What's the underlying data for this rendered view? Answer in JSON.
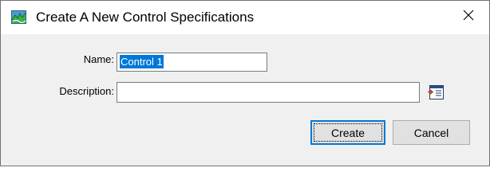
{
  "window": {
    "title": "Create A New Control Specifications",
    "app_icon": "hec-hms-icon",
    "close_icon": "close-icon"
  },
  "form": {
    "name_label": "Name:",
    "name_value": "Control 1",
    "description_label": "Description:",
    "description_value": "",
    "description_editor_icon": "text-editor-icon"
  },
  "buttons": {
    "create_label": "Create",
    "cancel_label": "Cancel"
  },
  "colors": {
    "selection": "#0078d7",
    "dialog_background": "#f0f0f0",
    "default_button_border": "#0078d7"
  }
}
